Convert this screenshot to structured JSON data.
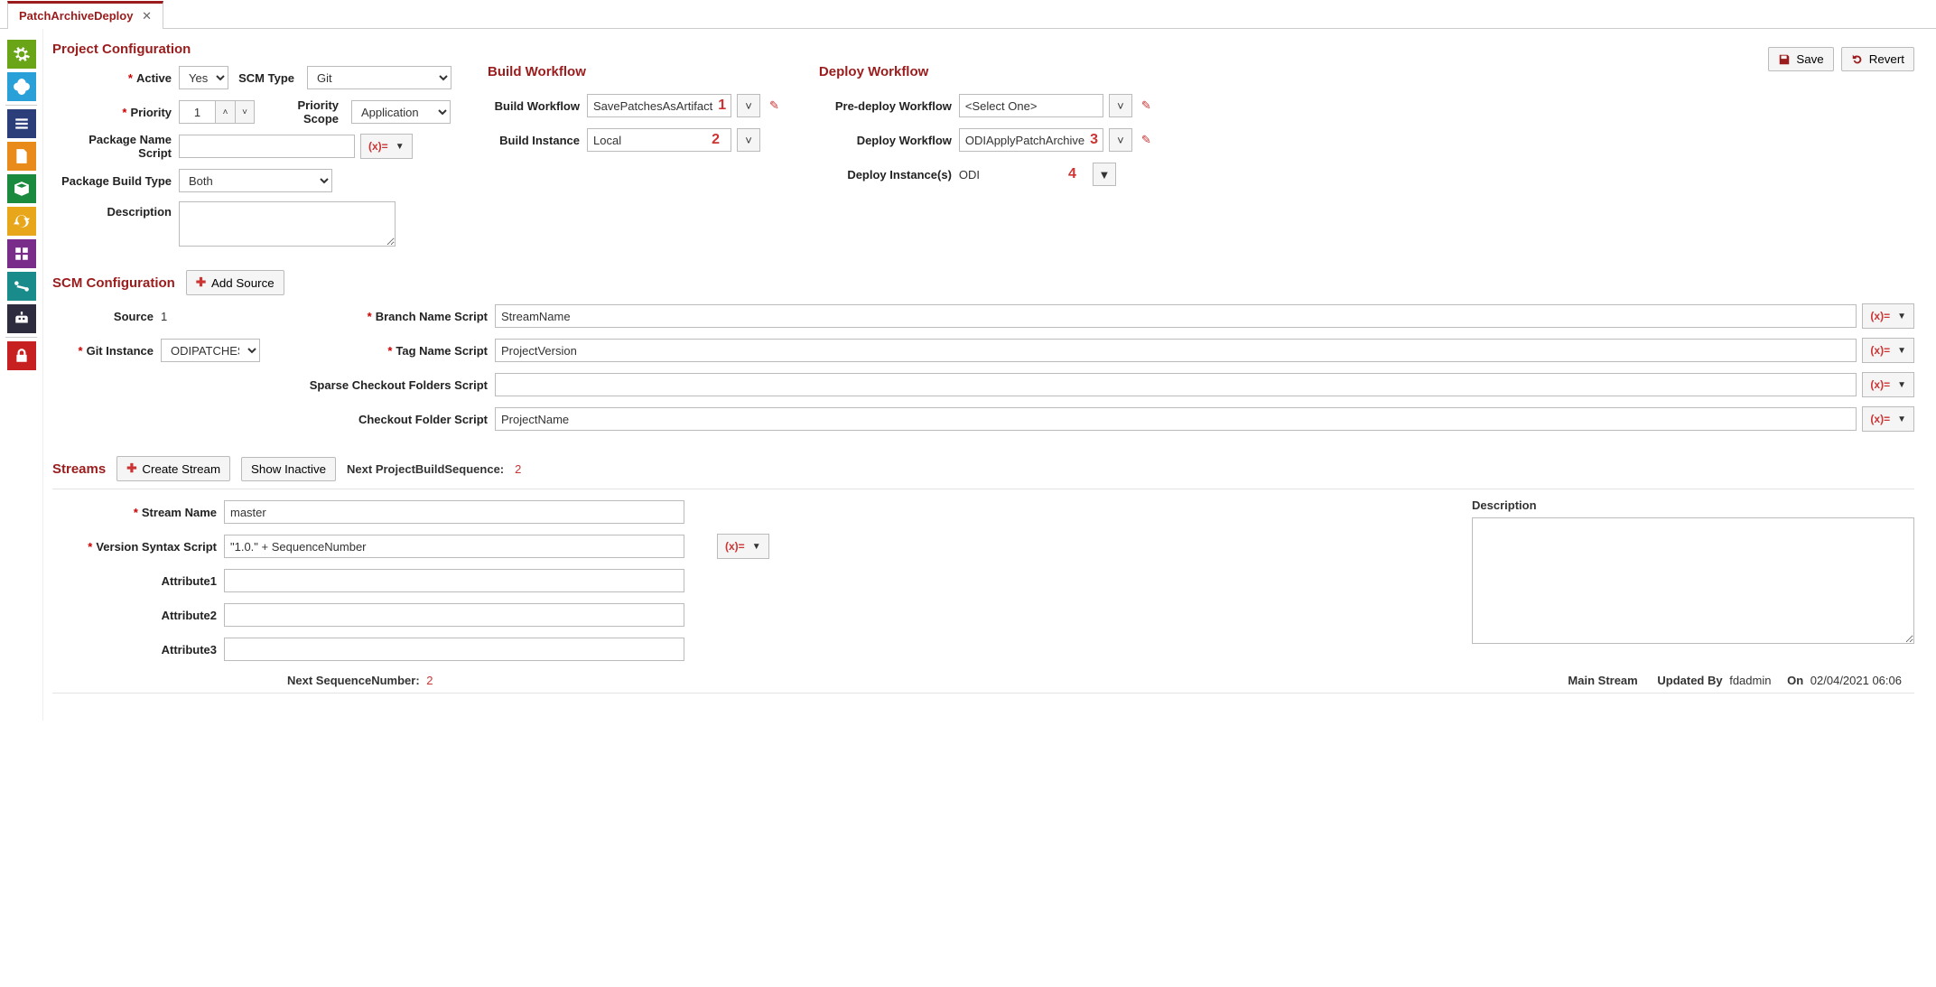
{
  "tab": {
    "title": "PatchArchiveDeploy"
  },
  "actions": {
    "save": "Save",
    "revert": "Revert"
  },
  "sidebar_icons": [
    "settings",
    "integration",
    "list",
    "document",
    "package",
    "sync",
    "template",
    "pipeline",
    "robot",
    "lock"
  ],
  "project": {
    "section_title": "Project Configuration",
    "labels": {
      "active": "Active",
      "scm_type": "SCM Type",
      "priority": "Priority",
      "priority_scope": "Priority Scope",
      "pkg_name_script": "Package Name Script",
      "pkg_build_type": "Package Build Type",
      "description": "Description"
    },
    "values": {
      "active": "Yes",
      "scm_type": "Git",
      "priority": "1",
      "priority_scope": "Application",
      "pkg_name_script": "",
      "pkg_build_type": "Both",
      "description": ""
    }
  },
  "build_wf": {
    "title": "Build Workflow",
    "labels": {
      "workflow": "Build Workflow",
      "instance": "Build Instance"
    },
    "values": {
      "workflow": "SavePatchesAsArtifact",
      "instance": "Local"
    },
    "nums": {
      "workflow": "1",
      "instance": "2"
    }
  },
  "deploy_wf": {
    "title": "Deploy Workflow",
    "labels": {
      "predeploy": "Pre-deploy Workflow",
      "workflow": "Deploy Workflow",
      "instances": "Deploy Instance(s)"
    },
    "values": {
      "predeploy": "<Select One>",
      "workflow": "ODIApplyPatchArchive",
      "instances": "ODI"
    },
    "nums": {
      "workflow": "3",
      "instances": "4"
    }
  },
  "scm": {
    "title": "SCM Configuration",
    "add_source": "Add Source",
    "labels": {
      "source": "Source",
      "git_instance": "Git Instance",
      "branch": "Branch Name Script",
      "tag": "Tag Name Script",
      "sparse": "Sparse Checkout Folders Script",
      "checkout": "Checkout Folder Script"
    },
    "values": {
      "source": "1",
      "git_instance": "ODIPATCHES",
      "branch": "StreamName",
      "tag": "ProjectVersion",
      "sparse": "",
      "checkout": "ProjectName"
    }
  },
  "streams": {
    "title": "Streams",
    "create": "Create Stream",
    "show_inactive": "Show Inactive",
    "next_seq_label": "Next ProjectBuildSequence:",
    "next_seq": "2",
    "labels": {
      "name": "Stream Name",
      "ver_script": "Version Syntax Script",
      "attr1": "Attribute1",
      "attr2": "Attribute2",
      "attr3": "Attribute3",
      "next_seqnum": "Next SequenceNumber:",
      "description": "Description"
    },
    "values": {
      "name": "master",
      "ver_script": "\"1.0.\" + SequenceNumber",
      "attr1": "",
      "attr2": "",
      "attr3": "",
      "next_seqnum": "2",
      "description": ""
    },
    "footer": {
      "main_stream": "Main Stream",
      "updated_by_label": "Updated By",
      "updated_by": "fdadmin",
      "on_label": "On",
      "on": "02/04/2021 06:06"
    }
  },
  "expr_btn": "(x)="
}
